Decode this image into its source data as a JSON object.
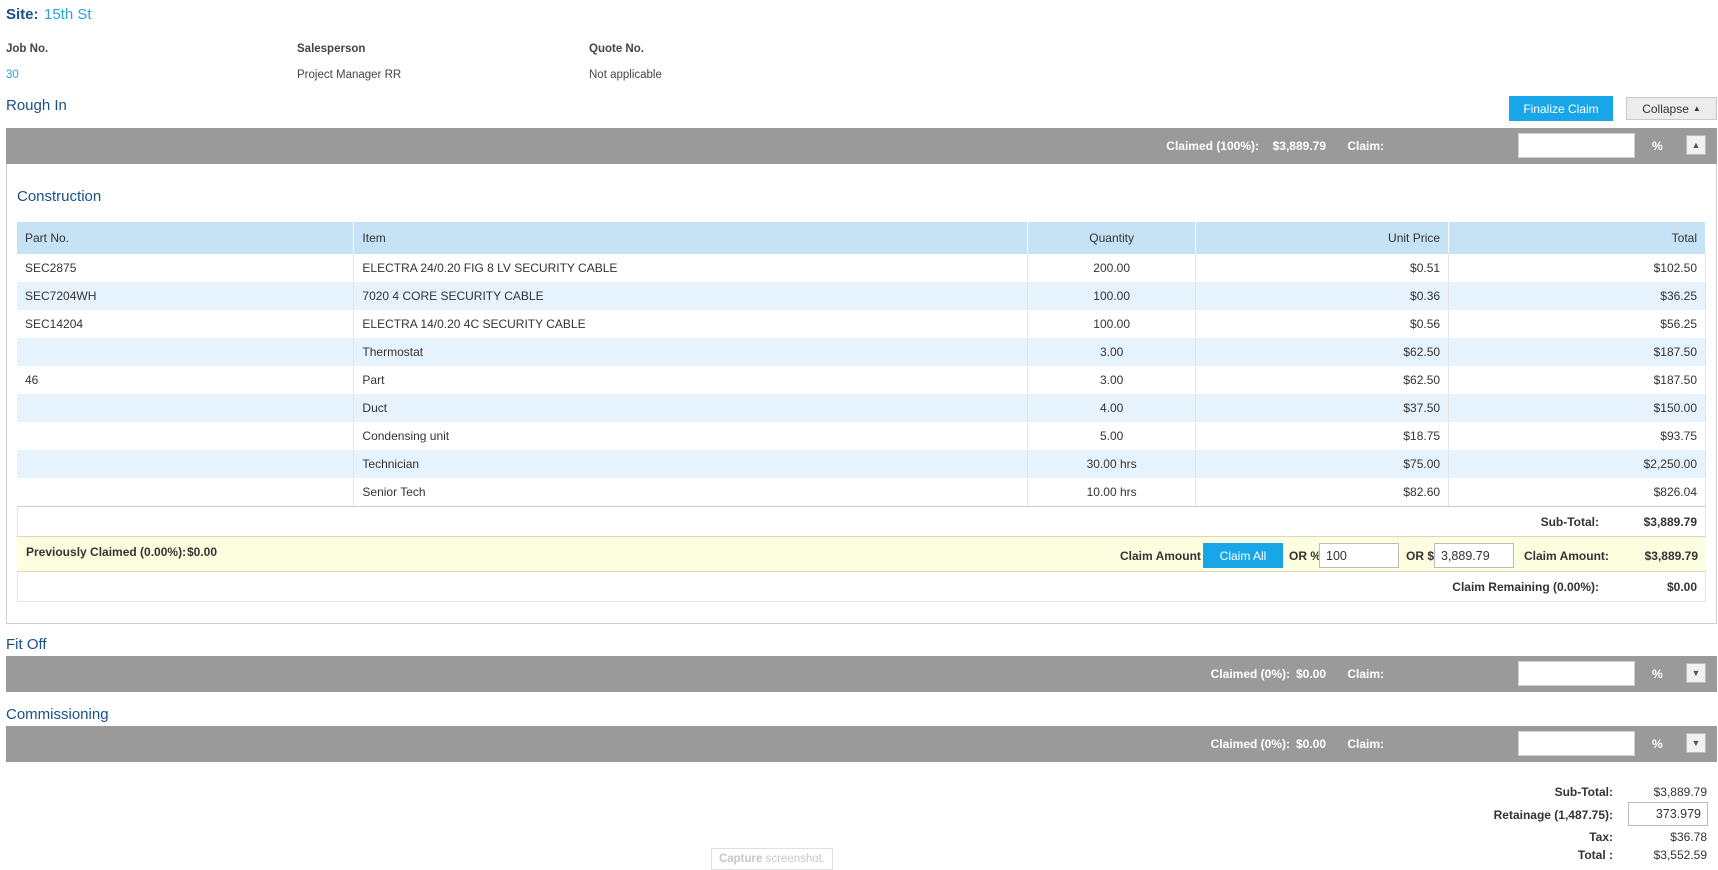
{
  "site": {
    "label": "Site:",
    "value": "15th St"
  },
  "info": {
    "job_label": "Job No.",
    "job_value": "30",
    "sales_label": "Salesperson",
    "sales_value": "Project Manager RR",
    "quote_label": "Quote No.",
    "quote_value": "Not applicable"
  },
  "rough_in": {
    "title": "Rough In",
    "finalize_label": "Finalize Claim",
    "collapse_label": "Collapse",
    "claimed_text": "Claimed (100%):",
    "claimed_value": "$3,889.79",
    "claim_label": "Claim:",
    "percent": "%",
    "subsection_title": "Construction",
    "columns": [
      "Part No.",
      "Item",
      "Quantity",
      "Unit Price",
      "Total"
    ],
    "rows": [
      [
        "SEC2875",
        "ELECTRA 24/0.20 FIG 8 LV SECURITY CABLE",
        "200.00",
        "$0.51",
        "$102.50"
      ],
      [
        "SEC7204WH",
        "7020 4 CORE SECURITY CABLE",
        "100.00",
        "$0.36",
        "$36.25"
      ],
      [
        "SEC14204",
        "ELECTRA 14/0.20 4C SECURITY CABLE",
        "100.00",
        "$0.56",
        "$56.25"
      ],
      [
        "",
        "Thermostat",
        "3.00",
        "$62.50",
        "$187.50"
      ],
      [
        "46",
        "Part",
        "3.00",
        "$62.50",
        "$187.50"
      ],
      [
        "",
        "Duct",
        "4.00",
        "$37.50",
        "$150.00"
      ],
      [
        "",
        "Condensing unit",
        "5.00",
        "$18.75",
        "$93.75"
      ],
      [
        "",
        "Technician",
        "30.00 hrs",
        "$75.00",
        "$2,250.00"
      ],
      [
        "",
        "Senior Tech",
        "10.00 hrs",
        "$82.60",
        "$826.04"
      ]
    ],
    "subtotal_label": "Sub-Total:",
    "subtotal_value": "$3,889.79",
    "prev_claimed_label": "Previously Claimed (0.00%):",
    "prev_claimed_value": "$0.00",
    "claim_amount_label": "Claim Amount",
    "claim_all_label": "Claim All",
    "or_percent": "OR %",
    "percent_value": "100",
    "or_dollar": "OR $",
    "dollar_value": "3,889.79",
    "claim_amount_label2": "Claim Amount:",
    "claim_amount_value": "$3,889.79",
    "remaining_label": "Claim Remaining (0.00%):",
    "remaining_value": "$0.00"
  },
  "fit_off": {
    "title": "Fit Off",
    "claimed_text": "Claimed (0%):",
    "claimed_value": "$0.00",
    "claim_label": "Claim:",
    "percent": "%"
  },
  "commissioning": {
    "title": "Commissioning",
    "claimed_text": "Claimed (0%):",
    "claimed_value": "$0.00",
    "claim_label": "Claim:",
    "percent": "%"
  },
  "totals": {
    "subtotal_label": "Sub-Total:",
    "subtotal_value": "$3,889.79",
    "retainage_label": "Retainage (1,487.75):",
    "retainage_value": "373.979",
    "tax_label": "Tax:",
    "tax_value": "$36.78",
    "total_label": "Total :",
    "total_value": "$3,552.59"
  },
  "watermark": {
    "bold": "Capture",
    "rest": " screenshot."
  },
  "colors": {
    "accent": "#19a6e8",
    "bar": "#9a9a9a",
    "title": "#1a4f8a",
    "row_alt": "#e6f2fc",
    "claim_row": "#fdfde0"
  }
}
